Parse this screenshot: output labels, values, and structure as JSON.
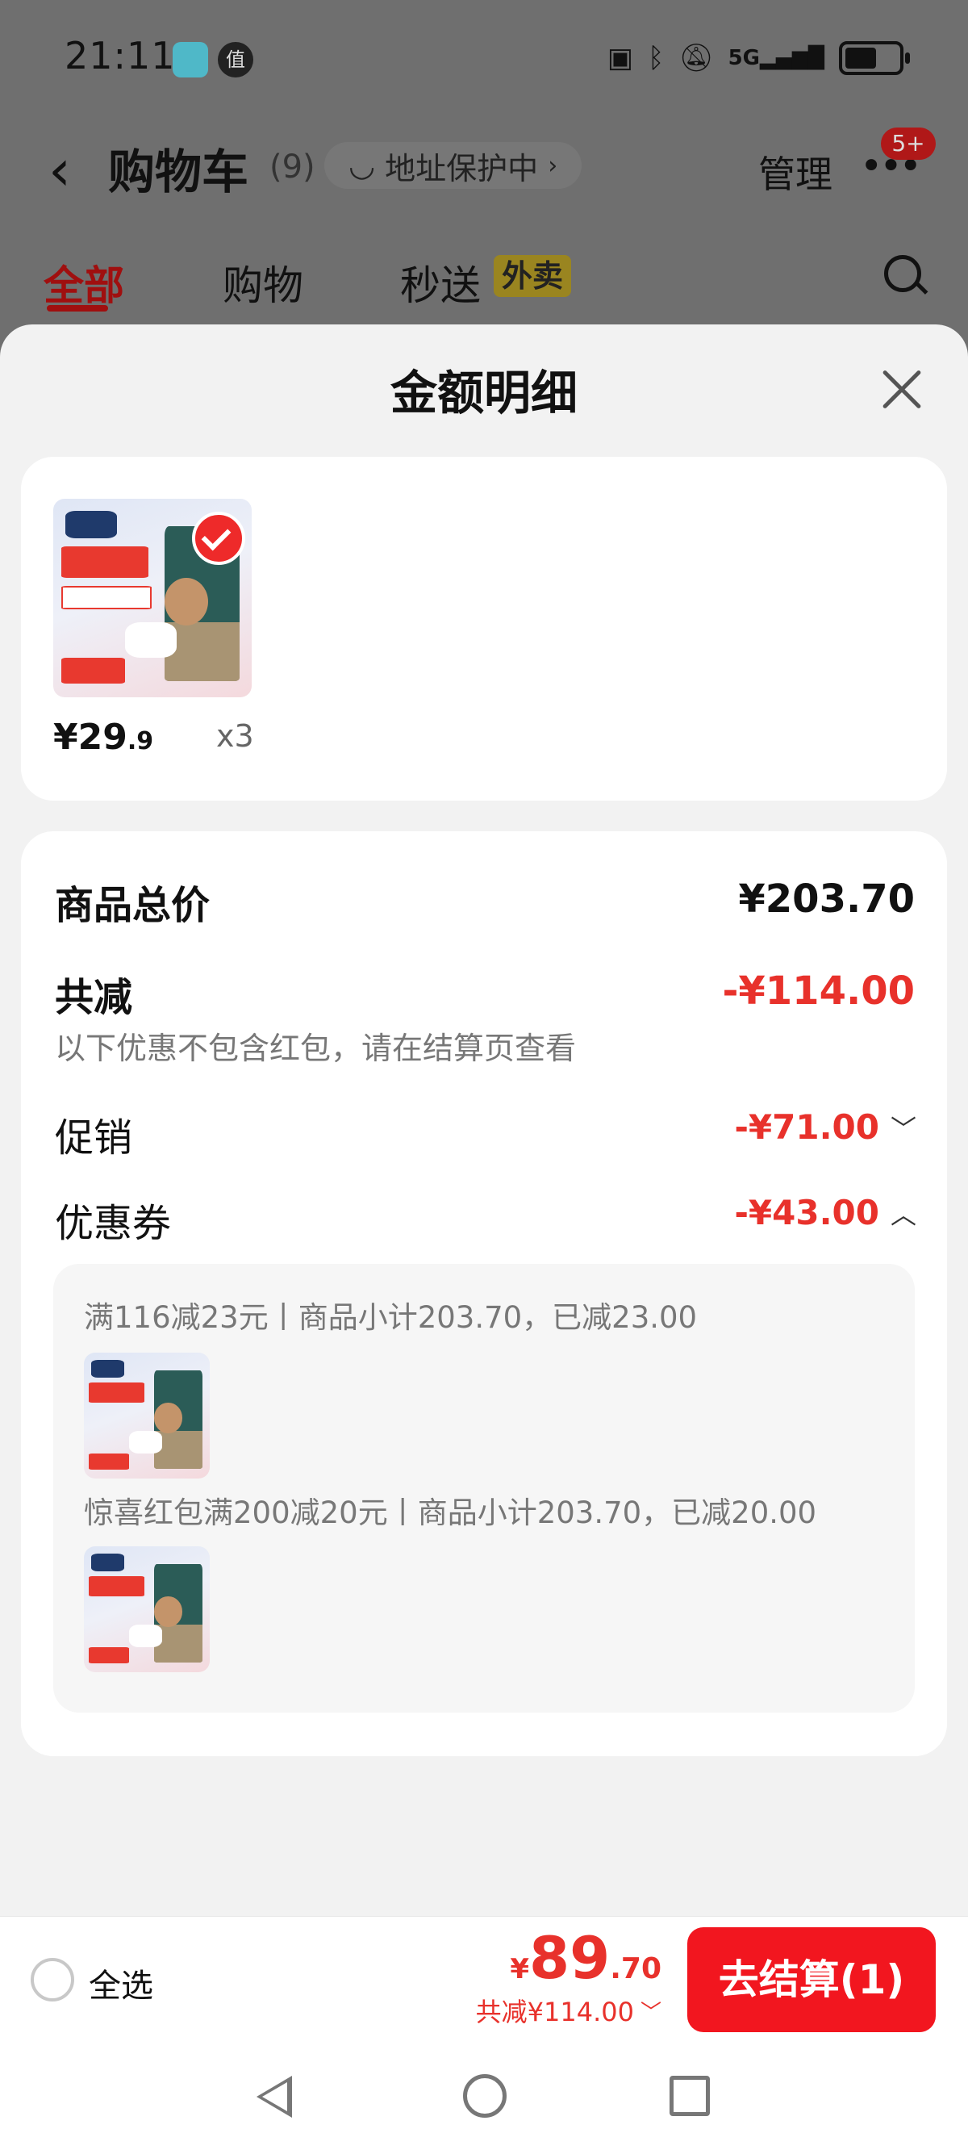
{
  "status_bar": {
    "time": "21:11",
    "app_badge": "值",
    "icons": [
      "nfc-icon",
      "bluetooth-icon",
      "mute-icon",
      "signal-5g-icon",
      "battery-icon"
    ],
    "network": "5G"
  },
  "cart_header": {
    "title": "购物车",
    "count": "(9)",
    "address_pill": "地址保护中",
    "manage": "管理",
    "more_badge": "5+"
  },
  "tabs": {
    "all": "全部",
    "shopping": "购物",
    "express": "秒送",
    "takeout_tag": "外卖"
  },
  "sheet": {
    "title": "金额明细",
    "product": {
      "price_int": "¥29",
      "price_dec": ".9",
      "qty": "x3"
    },
    "summary": {
      "total_label": "商品总价",
      "total_value": "¥203.70",
      "discount_label": "共减",
      "discount_value": "-¥114.00",
      "discount_note": "以下优惠不包含红包，请在结算页查看",
      "promo_label": "促销",
      "promo_value": "-¥71.00",
      "coupon_label": "优惠券",
      "coupon_value": "-¥43.00"
    },
    "coupon_details": [
      {
        "text": "满116减23元丨商品小计203.70，已减23.00"
      },
      {
        "text": "惊喜红包满200减20元丨商品小计203.70，已减20.00"
      }
    ]
  },
  "bottom_bar": {
    "select_all": "全选",
    "total_yen": "¥",
    "total_int": "89",
    "total_dec": ".70",
    "saved": "共减¥114.00",
    "checkout": "去结算(1)"
  },
  "colors": {
    "accent_red": "#e8312b",
    "checkout_red": "#f2161f",
    "sheet_bg": "#f2f2f2"
  }
}
